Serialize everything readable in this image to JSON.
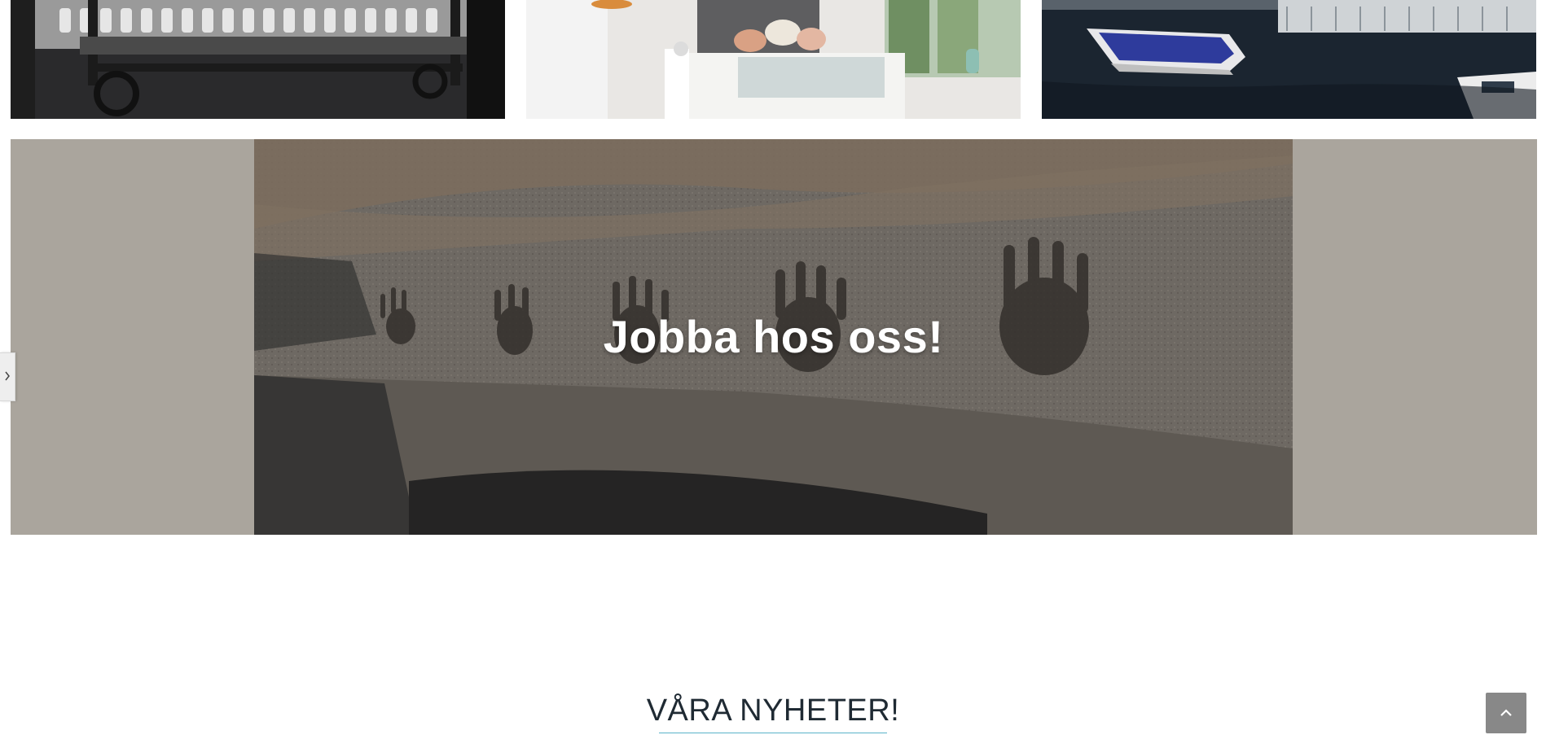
{
  "gallery": {
    "tiles": [
      {
        "alt": "furniture-cart-photo"
      },
      {
        "alt": "bedroom-photo"
      },
      {
        "alt": "boat-on-canal-photo"
      }
    ]
  },
  "banner": {
    "title": "Jobba hos oss!",
    "background_color": "#aaa59d"
  },
  "news": {
    "heading": "VÅRA NYHETER!",
    "underline_color": "#5ab3c9"
  },
  "controls": {
    "side_toggle_icon": "chevron-right-icon",
    "back_to_top_icon": "chevron-up-icon",
    "back_to_top_color": "#888888"
  }
}
